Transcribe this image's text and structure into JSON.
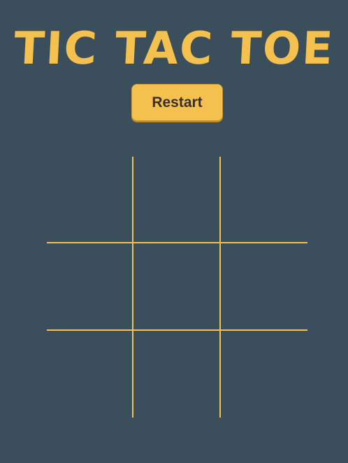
{
  "title": "TIC TAC TOE",
  "restart_label": "Restart",
  "colors": {
    "background": "#3a4f5b",
    "accent": "#f5c14e",
    "button_text": "#3a2f28"
  },
  "board": {
    "cells": [
      "",
      "",
      "",
      "",
      "",
      "",
      "",
      "",
      ""
    ]
  }
}
